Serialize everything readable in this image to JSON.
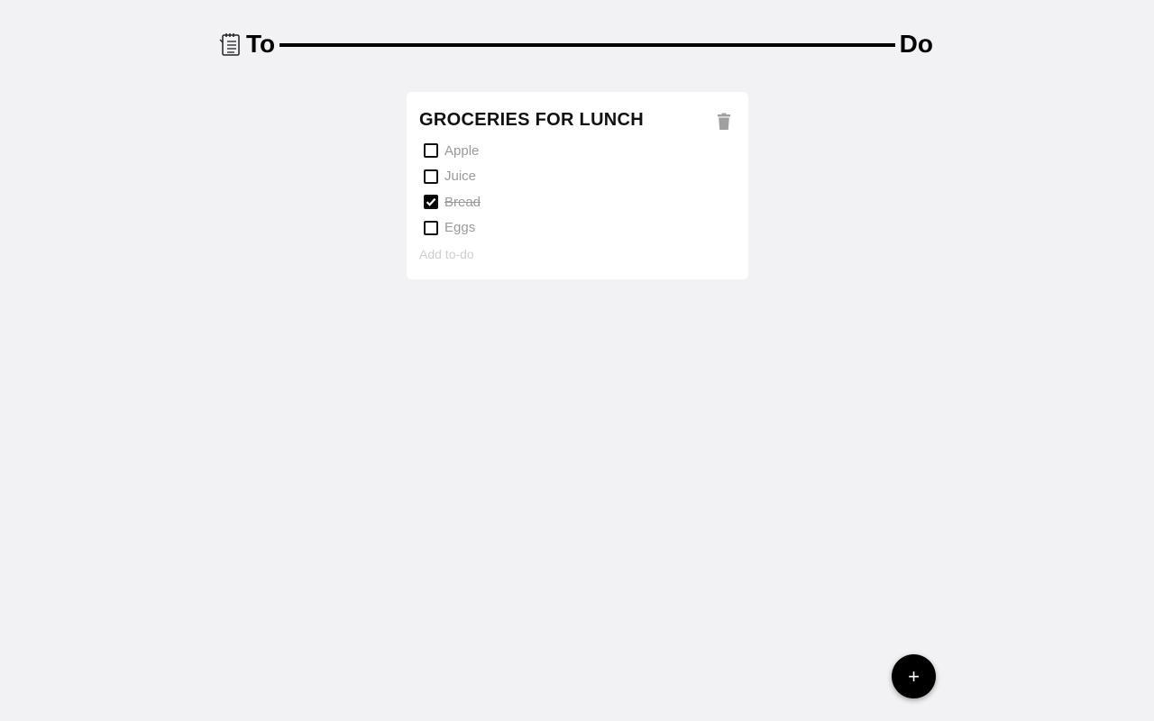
{
  "header": {
    "icon": "notepad-icon",
    "title_left": "To",
    "title_right": "Do"
  },
  "card": {
    "title": "GROCERIES FOR LUNCH",
    "delete_icon": "trash-icon",
    "todos": [
      {
        "label": "Apple",
        "checked": false
      },
      {
        "label": "Juice",
        "checked": false
      },
      {
        "label": "Bread",
        "checked": true
      },
      {
        "label": "Eggs",
        "checked": false
      }
    ],
    "add_placeholder": "Add to-do"
  },
  "fab": {
    "icon": "plus-icon",
    "label": "+"
  },
  "colors": {
    "background": "#f2f2f4",
    "card": "#ffffff",
    "accent": "#000000",
    "muted_text": "#9a9a9a",
    "trash": "#9e9e9e"
  }
}
